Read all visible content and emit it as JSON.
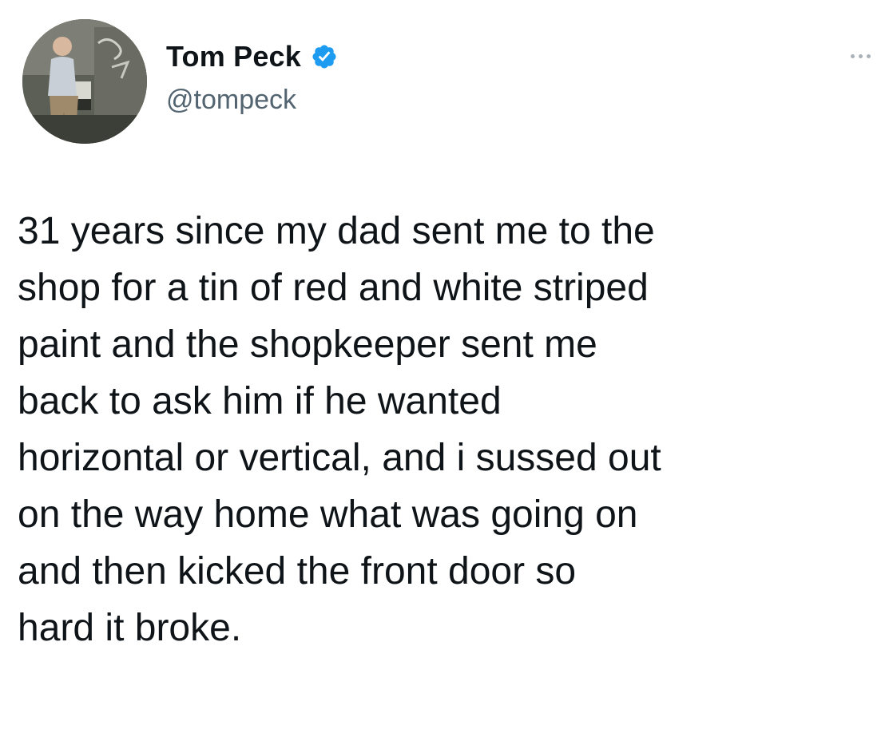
{
  "tweet": {
    "author": {
      "display_name": "Tom Peck",
      "handle": "@tompeck",
      "verified_icon": "verified-badge-icon",
      "avatar_icon": "profile-photo"
    },
    "more_icon": "more-options-icon",
    "text_lines": [
      "31 years since my dad sent me to the",
      "shop for a tin of red and white striped",
      "paint and the shopkeeper sent me",
      "back to ask him if he wanted",
      "horizontal or vertical, and i sussed out",
      "on the way home what was going on",
      "and then kicked the front door so",
      "hard it broke."
    ]
  },
  "colors": {
    "text": "#0f1419",
    "secondary": "#536471",
    "verified": "#1d9bf0",
    "background": "#ffffff"
  }
}
